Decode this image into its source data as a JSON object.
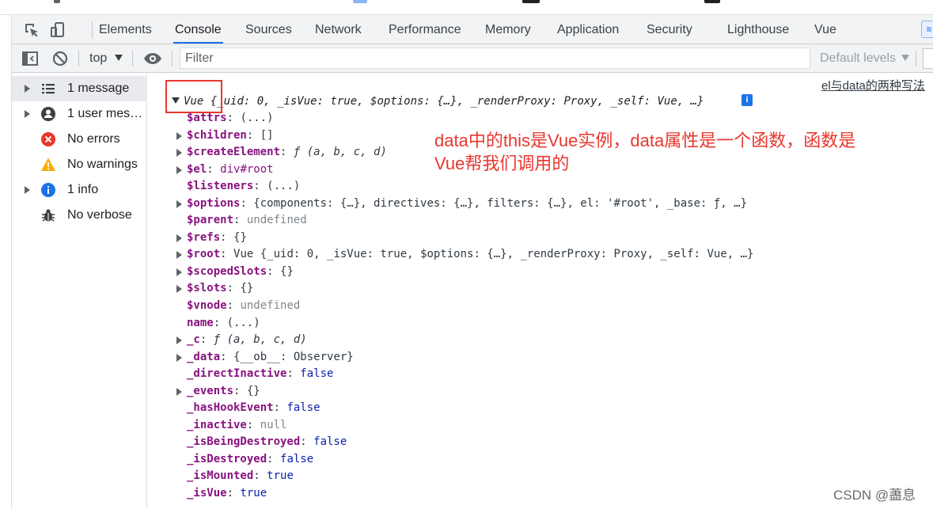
{
  "tabs": [
    {
      "label": "Elements"
    },
    {
      "label": "Console"
    },
    {
      "label": "Sources"
    },
    {
      "label": "Network"
    },
    {
      "label": "Performance"
    },
    {
      "label": "Memory"
    },
    {
      "label": "Application"
    },
    {
      "label": "Security"
    },
    {
      "label": "Lighthouse"
    },
    {
      "label": "Vue"
    }
  ],
  "toolbar": {
    "context": "top",
    "filter_placeholder": "Filter",
    "levels_label": "Default levels"
  },
  "sidebar": {
    "items": [
      {
        "label": "1 message",
        "icon": "list-icon"
      },
      {
        "label": "1 user mess...",
        "icon": "user-icon"
      },
      {
        "label": "No errors",
        "icon": "error-icon"
      },
      {
        "label": "No warnings",
        "icon": "warning-icon"
      },
      {
        "label": "1 info",
        "icon": "info-icon"
      },
      {
        "label": "No verbose",
        "icon": "bug-icon"
      }
    ]
  },
  "console": {
    "link_fragment": "el与data的两种写法",
    "object_header": {
      "name": "Vue",
      "summary": "{_uid: 0, _isVue: true, $options: {…}, _renderProxy: Proxy, _self: Vue, …}"
    },
    "properties": [
      {
        "key": "$attrs",
        "value": "(...)"
      },
      {
        "key": "$children",
        "value": "[]"
      },
      {
        "key": "$createElement",
        "value": "ƒ (a, b, c, d)"
      },
      {
        "key": "$el",
        "value": "div#root"
      },
      {
        "key": "$listeners",
        "value": "(...)"
      },
      {
        "key": "$options",
        "value": "{components: {…}, directives: {…}, filters: {…}, el: '#root', _base: ƒ, …}"
      },
      {
        "key": "$parent",
        "value": "undefined"
      },
      {
        "key": "$refs",
        "value": "{}"
      },
      {
        "key": "$root",
        "value": "Vue {_uid: 0, _isVue: true, $options: {…}, _renderProxy: Proxy, _self: Vue, …}"
      },
      {
        "key": "$scopedSlots",
        "value": "{}"
      },
      {
        "key": "$slots",
        "value": "{}"
      },
      {
        "key": "$vnode",
        "value": "undefined"
      },
      {
        "key": "name",
        "value": "(...)"
      },
      {
        "key": "_c",
        "value": "ƒ (a, b, c, d)"
      },
      {
        "key": "_data",
        "value": "{__ob__: Observer}"
      },
      {
        "key": "_directInactive",
        "value": "false"
      },
      {
        "key": "_events",
        "value": "{}"
      },
      {
        "key": "_hasHookEvent",
        "value": "false"
      },
      {
        "key": "_inactive",
        "value": "null"
      },
      {
        "key": "_isBeingDestroyed",
        "value": "false"
      },
      {
        "key": "_isDestroyed",
        "value": "false"
      },
      {
        "key": "_isMounted",
        "value": "true"
      },
      {
        "key": "_isVue",
        "value": "true"
      }
    ],
    "annotation_lines": [
      "data中的this是Vue实例，data属性是一个函数，函数是",
      "Vue帮我们调用的"
    ],
    "watermark": "CSDN @藎息"
  },
  "colors": {
    "accent": "#1a73e8",
    "annotation_red": "#e8372e",
    "property_key": "#881280"
  }
}
